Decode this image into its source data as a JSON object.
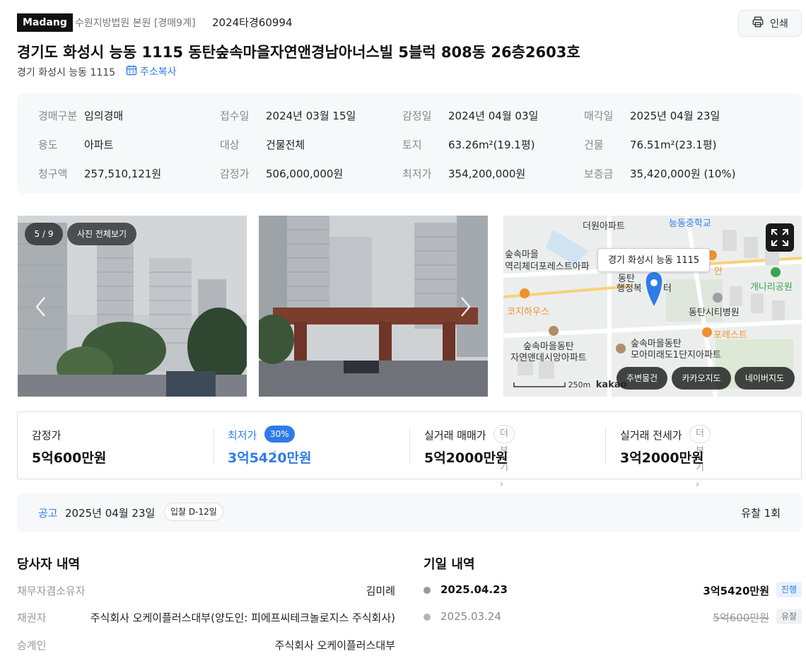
{
  "header": {
    "logo": "Madang",
    "court": "수원지방법원 본원 [경매9계]",
    "case_no": "2024타경60994",
    "print_label": "인쇄",
    "title": "경기도 화성시 능동 1115 동탄숲속마을자연앤경남아너스빌 5블럭 808동 26층2603호",
    "sub_address": "경기 화성시 능동 1115",
    "copy_address_label": "주소복사"
  },
  "info": {
    "row1": [
      {
        "k": "경매구분",
        "v": "임의경매"
      },
      {
        "k": "접수일",
        "v": "2024년 03월 15일"
      },
      {
        "k": "감정일",
        "v": "2024년 04월 03일"
      },
      {
        "k": "매각일",
        "v": "2025년 04월 23일"
      }
    ],
    "row2": [
      {
        "k": "용도",
        "v": "아파트"
      },
      {
        "k": "대상",
        "v": "건물전체"
      },
      {
        "k": "토지",
        "v": "63.26m²(19.1평)"
      },
      {
        "k": "건물",
        "v": "76.51m²(23.1평)"
      }
    ],
    "row3": [
      {
        "k": "청구액",
        "v": "257,510,121원"
      },
      {
        "k": "감정가",
        "v": "506,000,000원"
      },
      {
        "k": "최저가",
        "v": "354,200,000원"
      },
      {
        "k": "보증금",
        "v": "35,420,000원 (10%)"
      }
    ]
  },
  "gallery": {
    "counter": "5 / 9",
    "view_all": "사진 전체보기"
  },
  "map": {
    "tooltip": "경기 화성시 능동 1115",
    "labels": {
      "a": "더원아파트",
      "b": "능동중학교",
      "c": "숲속마을",
      "d": "역리체더포레스트아파",
      "e": "동탄",
      "f": "행정복",
      "g": "터",
      "h": "안",
      "i": "개나리공원",
      "j": "코지하우스",
      "k": "동탄시티병원",
      "l": "포레스트",
      "m": "숲속마을동탄",
      "n": "자연앤데시앙아파트",
      "o": "숲속마을동탄",
      "p": "모아미래도1단지아파트"
    },
    "scale": "250m",
    "brand": "kakao",
    "buttons": {
      "nearby": "주변물건",
      "kakao": "카카오지도",
      "naver": "네이버지도"
    }
  },
  "prices": {
    "appraisal_label": "감정가",
    "appraisal_value": "5억600만원",
    "min_label": "최저가",
    "min_badge": "30%",
    "min_value": "3억5420만원",
    "sale_label": "실거래 매매가",
    "sale_more": "더보기",
    "sale_value": "5억2000만원",
    "jeonse_label": "실거래 전세가",
    "jeonse_more": "더보기",
    "jeonse_value": "3억2000만원"
  },
  "notice": {
    "label": "공고",
    "date": "2025년 04월 23일",
    "dday": "입찰 D-12일",
    "fail_count": "유찰 1회"
  },
  "parties": {
    "title": "당사자 내역",
    "rows": [
      {
        "k": "채무자겸소유자",
        "v": "김미례"
      },
      {
        "k": "채권자",
        "v": "주식회사 오케이플러스대부(양도인: 피에프씨테크놀로지스 주식회사)"
      },
      {
        "k": "승계인",
        "v": "주식회사 오케이플러스대부"
      }
    ]
  },
  "dates": {
    "title": "기일 내역",
    "rows": [
      {
        "date": "2025.04.23",
        "price": "3억5420만원",
        "status": "진행"
      },
      {
        "date": "2025.03.24",
        "price": "5억600만원",
        "status": "유찰"
      }
    ]
  },
  "colors": {
    "accent": "#2f7ce7",
    "dark": "#111111",
    "muted": "#999999"
  }
}
